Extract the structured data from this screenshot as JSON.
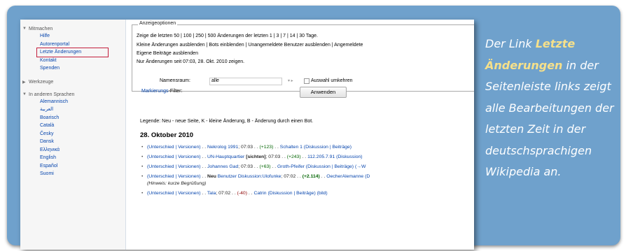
{
  "sidebar": {
    "groups": [
      {
        "head": "Mitmachen",
        "items": [
          "Hilfe",
          "Autorenportal",
          "Letzte Änderungen",
          "Kontakt",
          "Spenden"
        ]
      },
      {
        "head": "Werkzeuge",
        "items": []
      },
      {
        "head": "In anderen Sprachen",
        "items": [
          "Alemannisch",
          "العربية",
          "Boarisch",
          "Català",
          "Česky",
          "Dansk",
          "Ελληνικά",
          "English",
          "Español",
          "Suomi"
        ]
      }
    ],
    "highlighted": "Letzte Änderungen",
    "highlight_color": "#c31e3c"
  },
  "options": {
    "legend": "Anzeigeoptionen",
    "line1": "Zeige die letzten 50 | 100 | 250 | 500 Änderungen der letzten 1 | 3 | 7 | 14 | 30 Tage.",
    "line2": "Kleine Änderungen ausblenden | Bots einblenden | Unangemeldete Benutzer ausblenden | Angemeldete",
    "line3": "Eigene Beiträge ausblenden",
    "line4": "Nur Änderungen seit 07:03, 28. Okt. 2010 zeigen.",
    "namespace_label": "Namensraum:",
    "namespace_value": "alle",
    "invert_label": "Auswahl umkehren",
    "filter_link": "Markierungs",
    "filter_label": "-Filter:",
    "apply_button": "Anwenden"
  },
  "legend_line": "Legende: Neu - neue Seite, K - kleine Änderung, B - Änderung durch einen Bot.",
  "date_heading": "28. Oktober 2010",
  "changes": [
    {
      "links": "(Unterschied | Versionen)",
      "sep": " . . ",
      "title": "Nekrolog 1991",
      "time": "; 07:03",
      "delta": "(+123)",
      "delta_class": "pos",
      "user": "Schalten 1 (Diskussion | Beiträge)"
    },
    {
      "links": "(Unterschied | Versionen)",
      "sep": " . . ",
      "title": "UN-Hauptquartier",
      "flag": "[sichten]",
      "time": "; 07:03",
      "delta": "(+243)",
      "delta_class": "pos",
      "user": "112.205.7.91 (Diskussion)"
    },
    {
      "links": "(Unterschied | Versionen)",
      "sep": " . . ",
      "title": "Johannes Gad",
      "time": "; 07:03",
      "delta": "(+63)",
      "delta_class": "pos",
      "user": "Groth-Pfeifer (Diskussion | Beiträge) (→W"
    },
    {
      "links": "(Unterschied | Versionen)",
      "sep": " . . ",
      "new": "Neu",
      "title": "Benutzer Diskussion:Ulofunke",
      "time": "; 07:02",
      "delta": "(+2.114)",
      "delta_class": "pos",
      "user": "OecherAlemanne (D",
      "note": "(Hinweis: kurze Begrüßung)"
    },
    {
      "links": "(Unterschied | Versionen)",
      "sep": " . . ",
      "title": "Tala",
      "time": "; 07:02",
      "delta": "(-40)",
      "delta_class": "neg",
      "user": "Catrin (Diskussion | Beiträge) (bild)"
    }
  ],
  "caption": {
    "before": "Der Link ",
    "accent": "Letzte Änderungen",
    "after": " in der Seitenleiste links zeigt alle Bearbeitungen der letzten Zeit in der deutschsprachigen Wikipedia an."
  },
  "colors": {
    "frame": "#6fa1cc",
    "link": "#0645ad",
    "accent_text": "#f6e08a"
  }
}
